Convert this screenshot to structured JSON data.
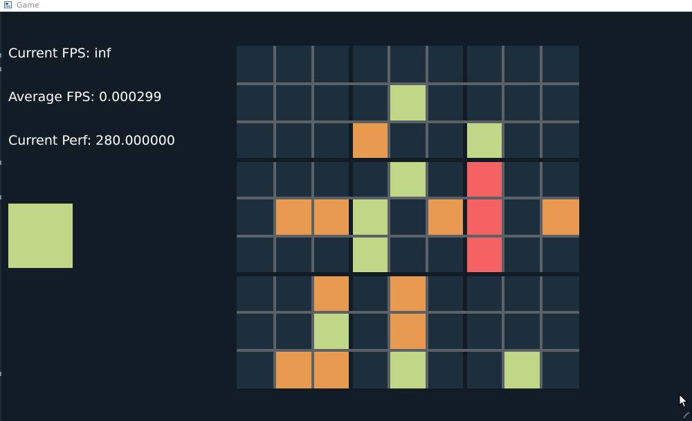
{
  "window": {
    "title": "Game"
  },
  "hud": {
    "current_fps": "Current FPS: inf",
    "average_fps": "Average FPS: 0.000299",
    "current_perf": "Current Perf: 280.000000"
  },
  "next_piece": {
    "color": "green"
  },
  "board": {
    "rows": 9,
    "cols": 9,
    "cells": [
      [
        "empty",
        "empty",
        "empty",
        "empty",
        "empty",
        "empty",
        "empty",
        "empty",
        "empty"
      ],
      [
        "empty",
        "empty",
        "empty",
        "empty",
        "green",
        "empty",
        "empty",
        "empty",
        "empty"
      ],
      [
        "empty",
        "empty",
        "empty",
        "orange",
        "empty",
        "empty",
        "green",
        "empty",
        "empty"
      ],
      [
        "empty",
        "empty",
        "empty",
        "empty",
        "green",
        "empty",
        "red",
        "empty",
        "empty"
      ],
      [
        "empty",
        "orange",
        "orange",
        "green",
        "empty",
        "orange",
        "red",
        "empty",
        "orange"
      ],
      [
        "empty",
        "empty",
        "empty",
        "green",
        "empty",
        "empty",
        "red",
        "empty",
        "empty"
      ],
      [
        "empty",
        "empty",
        "orange",
        "empty",
        "orange",
        "empty",
        "empty",
        "empty",
        "empty"
      ],
      [
        "empty",
        "empty",
        "green",
        "empty",
        "orange",
        "empty",
        "empty",
        "empty",
        "empty"
      ],
      [
        "empty",
        "orange",
        "orange",
        "empty",
        "green",
        "empty",
        "empty",
        "green",
        "empty"
      ]
    ]
  },
  "colors": {
    "background": "#121c26",
    "empty": "#1d2e3d",
    "grid_line": "#5b6167",
    "green": "#bfd786",
    "orange": "#e89b50",
    "red": "#f46363"
  }
}
